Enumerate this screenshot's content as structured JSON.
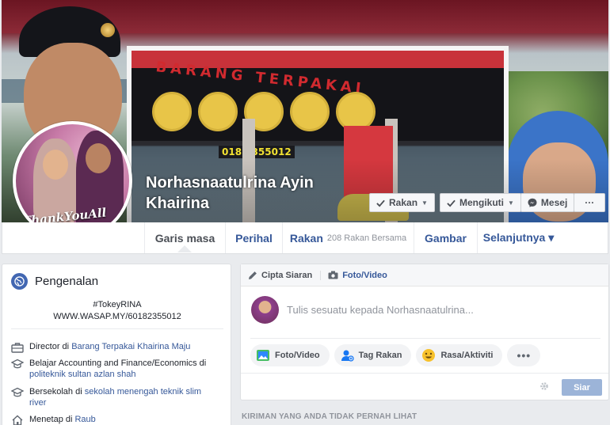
{
  "profile": {
    "name": "Norhasnaatulrina Ayin Khairina",
    "cover_sign_text": "BARANG TERPAKAI",
    "cover_phone_text": "018 2355012",
    "avatar_text": "ThankYouAll"
  },
  "cover_actions": {
    "friends_label": "Rakan",
    "following_label": "Mengikuti",
    "message_label": "Mesej",
    "more_label": "···"
  },
  "tabs": [
    {
      "label": "Garis masa",
      "active": true
    },
    {
      "label": "Perihal"
    },
    {
      "label": "Rakan",
      "sub": "208 Rakan Bersama"
    },
    {
      "label": "Gambar"
    },
    {
      "label": "Selanjutnya ▾"
    }
  ],
  "intro": {
    "title": "Pengenalan",
    "bio_line1": "#TokeyRINA",
    "bio_line2": "WWW.WASAP.MY/60182355012",
    "items": [
      {
        "prefix": "Director di ",
        "link": "Barang Terpakai Khairina Maju",
        "icon": "briefcase-icon"
      },
      {
        "prefix": "Belajar Accounting and Finance/Economics di ",
        "link": "politeknik sultan azlan shah",
        "icon": "graduation-cap-icon"
      },
      {
        "prefix": "Bersekolah di ",
        "link": "sekolah menengah teknik slim river",
        "icon": "graduation-cap-icon"
      },
      {
        "prefix": "Menetap di ",
        "link": "Raub",
        "icon": "home-icon"
      }
    ]
  },
  "composer": {
    "tab_create": "Cipta Siaran",
    "tab_photo": "Foto/Video",
    "placeholder": "Tulis sesuatu kepada Norhasnaatulrina...",
    "chips": [
      "Foto/Video",
      "Tag Rakan",
      "Rasa/Aktiviti",
      "•••"
    ],
    "post_label": "Siar"
  },
  "section_heading": "KIRIMAN YANG ANDA TIDAK PERNAH LIHAT",
  "colors": {
    "link": "#365899",
    "brand": "#4267b2",
    "page_bg": "#e9ebee",
    "post_button_disabled": "#9cb4d8"
  }
}
